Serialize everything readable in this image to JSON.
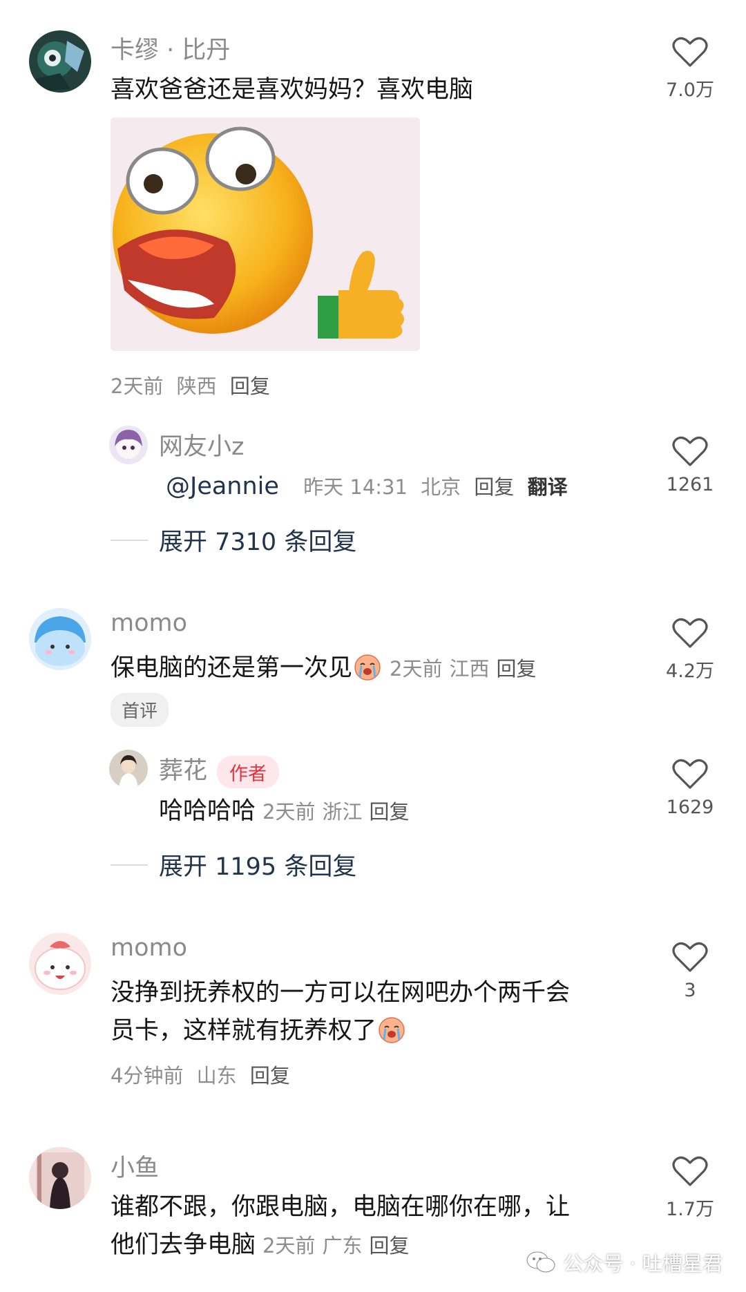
{
  "comments": [
    {
      "username": "卡缪 · 比丹",
      "text": "喜欢爸爸还是喜欢妈妈？喜欢电脑",
      "time": "2天前",
      "location": "陕西",
      "reply_label": "回复",
      "likes": "7.0万",
      "reply": {
        "username": "网友小z",
        "mention": "@Jeannie",
        "time": "昨天 14:31",
        "location": "北京",
        "reply_label": "回复",
        "translate_label": "翻译",
        "likes": "1261"
      },
      "expand_label": "展开 7310 条回复"
    },
    {
      "username": "momo",
      "text": "保电脑的还是第一次见",
      "time": "2天前",
      "location": "江西",
      "reply_label": "回复",
      "likes": "4.2万",
      "tag": "首评",
      "reply": {
        "username": "葬花",
        "author_tag": "作者",
        "text": "哈哈哈哈",
        "time": "2天前",
        "location": "浙江",
        "reply_label": "回复",
        "likes": "1629"
      },
      "expand_label": "展开 1195 条回复"
    },
    {
      "username": "momo",
      "text_line1": "没挣到抚养权的一方可以在网吧办个两千会",
      "text_line2": "员卡，这样就有抚养权了",
      "time": "4分钟前",
      "location": "山东",
      "reply_label": "回复",
      "likes": "3"
    },
    {
      "username": "小鱼",
      "text_line1": "谁都不跟，你跟电脑，电脑在哪你在哪，让",
      "text_line2": "他们去争电脑",
      "time": "2天前",
      "location": "广东",
      "reply_label": "回复",
      "likes": "1.7万"
    }
  ],
  "watermark": "公众号 · 吐槽星君",
  "icons": {
    "like": "heart-outline-icon",
    "cry": "crying-face-emoji"
  },
  "colors": {
    "text": "#161616",
    "meta": "#8d8d8d",
    "expand": "#22334d",
    "author_tag_bg": "#fde7ea",
    "author_tag_fg": "#e0343f"
  }
}
